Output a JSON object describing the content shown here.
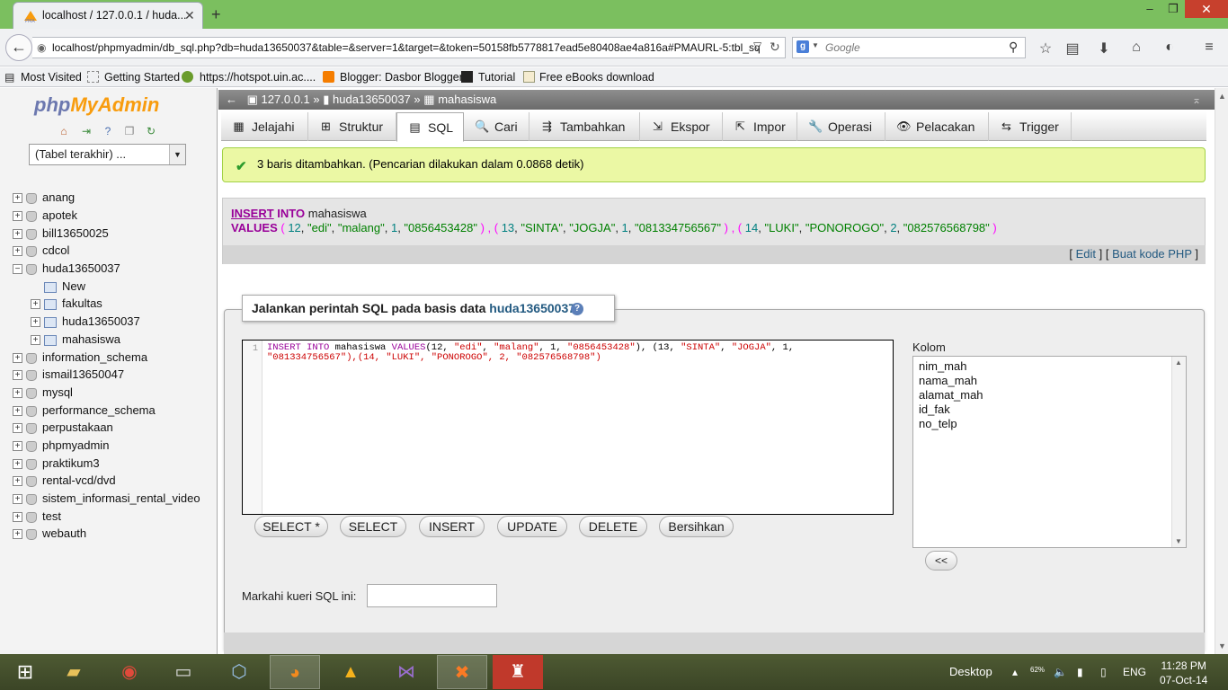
{
  "browser": {
    "tab_title": "localhost / 127.0.0.1 / huda...",
    "tab_close": "✕",
    "new_tab": "+",
    "window_controls": [
      "‒",
      "❐",
      "✕"
    ],
    "url": "localhost/phpmyadmin/db_sql.php?db=huda13650037&table=&server=1&target=&token=50158fb5778817ead5e80408ae4a816a#PMAURL-5:tbl_sq",
    "search_placeholder": "Google",
    "bookmarks": [
      "Most Visited",
      "Getting Started",
      "https://hotspot.uin.ac....",
      "Blogger: Dasbor Blogger",
      "Tutorial",
      "Free eBooks download"
    ]
  },
  "sidebar": {
    "logo_php": "php",
    "logo_myadmin": "MyAdmin",
    "recent_select": "(Tabel terakhir) ...",
    "databases": [
      {
        "name": "anang",
        "expand": "+",
        "type": "db"
      },
      {
        "name": "apotek",
        "expand": "+",
        "type": "db"
      },
      {
        "name": "bill13650025",
        "expand": "+",
        "type": "db"
      },
      {
        "name": "cdcol",
        "expand": "+",
        "type": "db"
      },
      {
        "name": "huda13650037",
        "expand": "−",
        "type": "db"
      },
      {
        "name": "New",
        "expand": "",
        "type": "new"
      },
      {
        "name": "fakultas",
        "expand": "+",
        "type": "table"
      },
      {
        "name": "huda13650037",
        "expand": "+",
        "type": "table"
      },
      {
        "name": "mahasiswa",
        "expand": "+",
        "type": "table"
      },
      {
        "name": "information_schema",
        "expand": "+",
        "type": "db"
      },
      {
        "name": "ismail13650047",
        "expand": "+",
        "type": "db"
      },
      {
        "name": "mysql",
        "expand": "+",
        "type": "db"
      },
      {
        "name": "performance_schema",
        "expand": "+",
        "type": "db"
      },
      {
        "name": "perpustakaan",
        "expand": "+",
        "type": "db"
      },
      {
        "name": "phpmyadmin",
        "expand": "+",
        "type": "db"
      },
      {
        "name": "praktikum3",
        "expand": "+",
        "type": "db"
      },
      {
        "name": "rental-vcd/dvd",
        "expand": "+",
        "type": "db"
      },
      {
        "name": "sistem_informasi_rental_video",
        "expand": "+",
        "type": "db"
      },
      {
        "name": "test",
        "expand": "+",
        "type": "db"
      },
      {
        "name": "webauth",
        "expand": "+",
        "type": "db"
      }
    ]
  },
  "breadcrumb": {
    "server": "127.0.0.1",
    "sep1": "»",
    "database": "huda13650037",
    "sep2": "»",
    "table": "mahasiswa"
  },
  "tabs": [
    {
      "label": "Jelajahi",
      "icon": "▦"
    },
    {
      "label": "Struktur",
      "icon": "⊞"
    },
    {
      "label": "SQL",
      "icon": "▤"
    },
    {
      "label": "Cari",
      "icon": "🔍"
    },
    {
      "label": "Tambahkan",
      "icon": "⇶"
    },
    {
      "label": "Ekspor",
      "icon": "⇲"
    },
    {
      "label": "Impor",
      "icon": "⇱"
    },
    {
      "label": "Operasi",
      "icon": "🔧"
    },
    {
      "label": "Pelacakan",
      "icon": "👁"
    },
    {
      "label": "Trigger",
      "icon": "⇆"
    }
  ],
  "active_tab": "SQL",
  "message": {
    "success": "3 baris ditambahkan. (Pencarian dilakukan dalam 0.0868 detik)"
  },
  "query": {
    "insert": "INSERT",
    "into": "INTO",
    "table": "mahasiswa",
    "values_kw": "VALUES",
    "rows": [
      [
        "12",
        "\"edi\"",
        "\"malang\"",
        "1",
        "\"0856453428\""
      ],
      [
        "13",
        "\"SINTA\"",
        "\"JOGJA\"",
        "1",
        "\"081334756567\""
      ],
      [
        "14",
        "\"LUKI\"",
        "\"PONOROGO\"",
        "2",
        "\"082576568798\""
      ]
    ],
    "edit_link": "Edit",
    "php_link": "Buat kode PHP"
  },
  "sql_form": {
    "legend_prefix": "Jalankan perintah SQL pada basis data",
    "legend_db": "huda13650037:",
    "line_number": "1",
    "code_line1": "INSERT INTO mahasiswa VALUES(12, \"edi\", \"malang\", 1, \"0856453428\"), (13, \"SINTA\", \"JOGJA\", 1,",
    "code_line2": "\"081334756567\"),(14, \"LUKI\", \"PONOROGO\", 2, \"082576568798\")",
    "buttons": [
      "SELECT *",
      "SELECT",
      "INSERT",
      "UPDATE",
      "DELETE",
      "Bersihkan"
    ],
    "columns_label": "Kolom",
    "columns": [
      "nim_mah",
      "nama_mah",
      "alamat_mah",
      "id_fak",
      "no_telp"
    ],
    "insert_column_button": "<<",
    "bookmark_label": "Markahi kueri SQL ini:"
  },
  "taskbar": {
    "desktop_label": "Desktop",
    "language": "ENG",
    "time": "11:28 PM",
    "date": "07-Oct-14",
    "net_speed": "62%"
  },
  "colors": {
    "titlebar": "#7bbf5f",
    "success_bg": "#ebf8a4",
    "keyword": "#990099",
    "link": "#235a81"
  }
}
